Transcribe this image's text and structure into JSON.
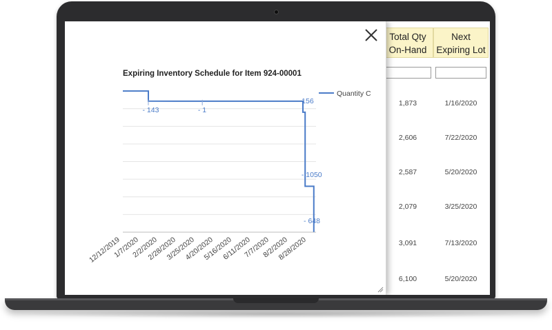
{
  "table": {
    "headers": [
      {
        "line1": "Total Qty",
        "line2": "On-Hand"
      },
      {
        "line1": "Next",
        "line2": "Expiring Lot"
      }
    ],
    "rows": [
      {
        "qty": "1,873",
        "lot": "1/16/2020"
      },
      {
        "qty": "2,606",
        "lot": "7/22/2020"
      },
      {
        "qty": "2,587",
        "lot": "5/20/2020"
      },
      {
        "qty": "2,079",
        "lot": "3/25/2020"
      },
      {
        "qty": "3,091",
        "lot": "7/13/2020"
      },
      {
        "qty": "6,100",
        "lot": "5/20/2020"
      }
    ]
  },
  "modal": {
    "close_icon": "close-x-icon"
  },
  "chart_data": {
    "type": "line",
    "title": "Expiring Inventory Schedule for Item 924-00001",
    "legend": {
      "label": "Quantity C",
      "position": "right"
    },
    "x_ticks": [
      "12/12/2019",
      "1/7/2020",
      "2/2/2020",
      "2/28/2020",
      "3/25/2020",
      "4/20/2020",
      "5/16/2020",
      "6/11/2020",
      "7/7/2020",
      "8/2/2020",
      "8/28/2020"
    ],
    "grid": true,
    "data_labels": [
      "- 143",
      "- 1",
      "-156",
      "- 1050",
      "- 648"
    ],
    "series": [
      {
        "name": "Quantity C",
        "color": "#4a7bc8",
        "points": [
          {
            "date": "12/12/2019",
            "y": 0
          },
          {
            "date": "1/16/2020",
            "y": 0
          },
          {
            "date": "1/16/2020",
            "y": -143
          },
          {
            "date": "8/15/2020",
            "y": -144
          },
          {
            "date": "8/15/2020",
            "y": -300
          },
          {
            "date": "8/18/2020",
            "y": -300
          },
          {
            "date": "8/18/2020",
            "y": -1350
          },
          {
            "date": "8/30/2020",
            "y": -1350
          },
          {
            "date": "8/30/2020",
            "y": -1998
          }
        ]
      }
    ],
    "y_range": [
      -2000,
      50
    ],
    "x_range": [
      "12/12/2019",
      "9/2/2020"
    ]
  }
}
